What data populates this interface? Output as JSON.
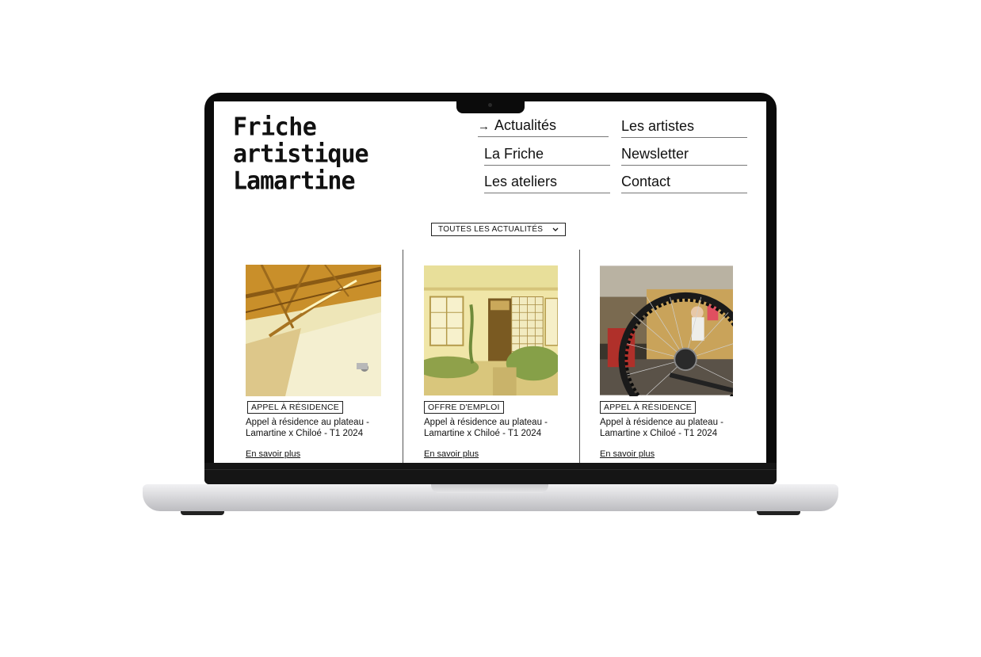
{
  "site": {
    "logo_lines": [
      "Friche",
      "artistique",
      "Lamartine"
    ]
  },
  "nav": {
    "items": [
      {
        "label": "Actualités",
        "active": true
      },
      {
        "label": "Les artistes"
      },
      {
        "label": "La Friche"
      },
      {
        "label": "Newsletter"
      },
      {
        "label": "Les ateliers"
      },
      {
        "label": "Contact"
      }
    ],
    "active_arrow": "→"
  },
  "filter": {
    "selected": "TOUTES LES ACTUALITÉS",
    "chevron": "⌄"
  },
  "cards": [
    {
      "tag": "APPEL À RÉSIDENCE",
      "title_1": "Appel à résidence au plateau -",
      "title_2": "Lamartine x Chiloé - T1 2024",
      "link": "En savoir plus",
      "image": "warehouse-ceiling-photo"
    },
    {
      "tag": "OFFRE D'EMPLOI",
      "title_1": "Appel à résidence au plateau -",
      "title_2": "Lamartine x Chiloé - T1 2024",
      "link": "En savoir plus",
      "image": "house-facade-photo"
    },
    {
      "tag": "APPEL À RÉSIDENCE",
      "title_1": "Appel à résidence au plateau -",
      "title_2": "Lamartine x Chiloé - T1 2024",
      "link": "En savoir plus",
      "image": "bicycle-wheel-workshop-photo"
    }
  ],
  "colors": {
    "accent": "#111111",
    "photo_warm": "#d8a83a",
    "laptop_body": "#0b0b0b",
    "laptop_base": "#d9d9dc"
  }
}
